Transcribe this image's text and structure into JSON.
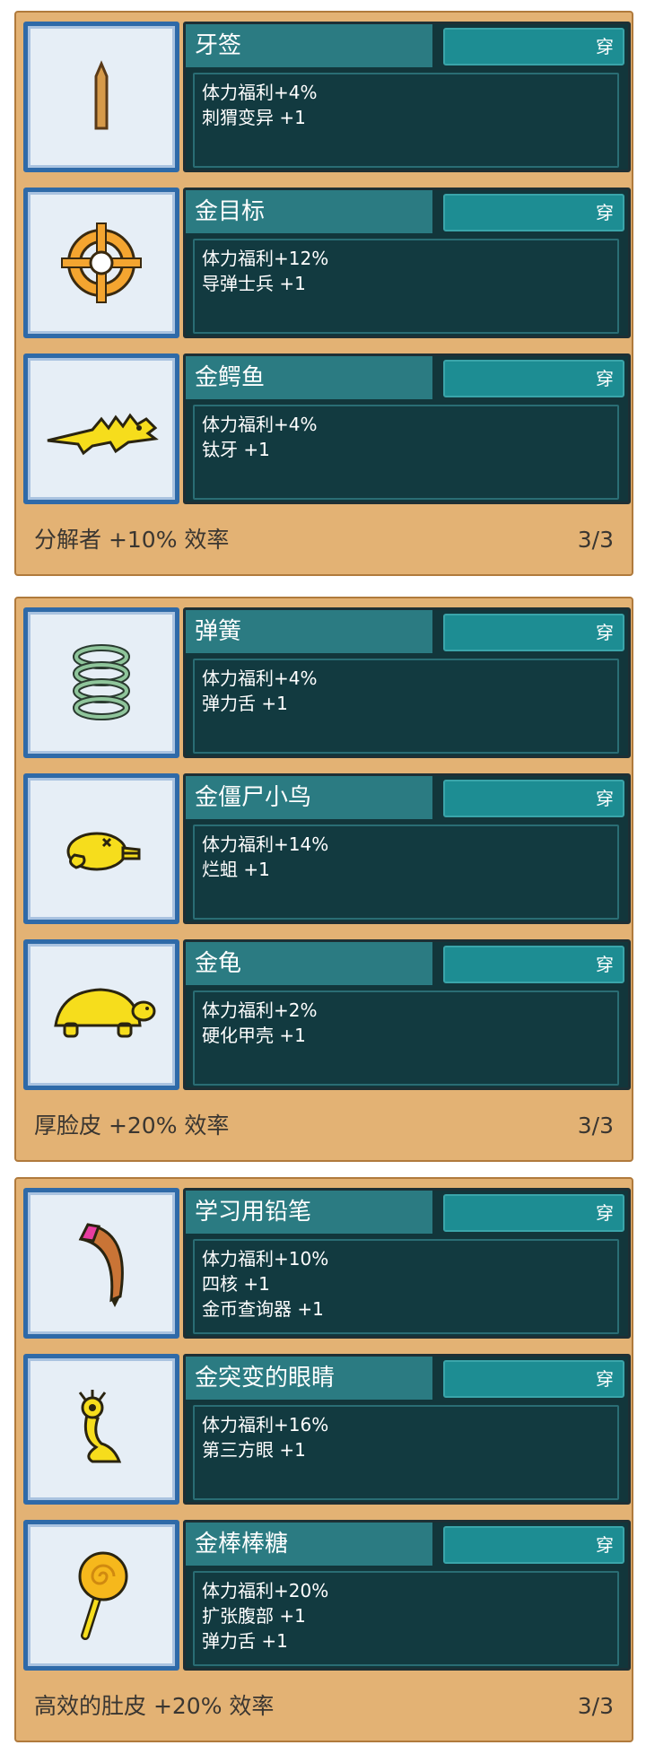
{
  "sets": [
    {
      "bonus": "分解者 +10% 效率",
      "count": "3/3",
      "items": [
        {
          "name": "牙签",
          "icon": "toothpick-icon",
          "equip": "穿",
          "stats": [
            "体力福利+4%",
            "刺猬变异 +1"
          ]
        },
        {
          "name": "金目标",
          "icon": "gold-target-icon",
          "equip": "穿",
          "stats": [
            "体力福利+12%",
            "导弹士兵 +1"
          ]
        },
        {
          "name": "金鳄鱼",
          "icon": "gold-crocodile-icon",
          "equip": "穿",
          "stats": [
            "体力福利+4%",
            "钛牙 +1"
          ]
        }
      ]
    },
    {
      "bonus": "厚脸皮 +20% 效率",
      "count": "3/3",
      "items": [
        {
          "name": "弹簧",
          "icon": "spring-icon",
          "equip": "穿",
          "stats": [
            "体力福利+4%",
            "弹力舌 +1"
          ]
        },
        {
          "name": "金僵尸小鸟",
          "icon": "gold-zombie-bird-icon",
          "equip": "穿",
          "stats": [
            "体力福利+14%",
            "烂蛆 +1"
          ]
        },
        {
          "name": "金龟",
          "icon": "gold-turtle-icon",
          "equip": "穿",
          "stats": [
            "体力福利+2%",
            "硬化甲壳 +1"
          ]
        }
      ]
    },
    {
      "bonus": "高效的肚皮 +20% 效率",
      "count": "3/3",
      "items": [
        {
          "name": "学习用铅笔",
          "icon": "pencil-icon",
          "equip": "穿",
          "stats": [
            "体力福利+10%",
            "四核 +1",
            "金币查询器 +1"
          ]
        },
        {
          "name": "金突变的眼睛",
          "icon": "gold-mutant-eye-icon",
          "equip": "穿",
          "stats": [
            "体力福利+16%",
            "第三方眼 +1"
          ]
        },
        {
          "name": "金棒棒糖",
          "icon": "gold-lollipop-icon",
          "equip": "穿",
          "stats": [
            "体力福利+20%",
            "扩张腹部 +1",
            "弹力舌 +1"
          ]
        }
      ]
    }
  ]
}
